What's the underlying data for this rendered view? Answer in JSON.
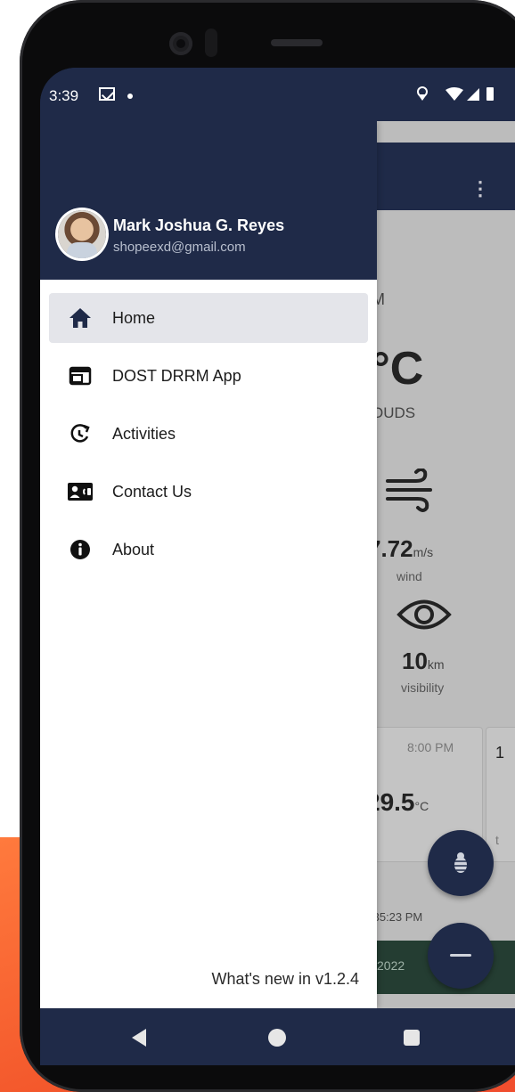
{
  "status_bar": {
    "time": "3:39",
    "right_icons": "⚲ ▾◢▮"
  },
  "background_app": {
    "menu_glyph": "⋮",
    "time_fragment": "M",
    "temp_fragment": "°C",
    "cond_fragment": "OUDS",
    "wind_value": "7.72",
    "wind_unit": "m/s",
    "wind_label": "wind",
    "visibility_value": "10",
    "visibility_unit": "km",
    "visibility_label": "visibility",
    "card_time": "8:00 PM",
    "card_temp": "29.5",
    "card_temp_unit": "°C",
    "card2_fragment": "1",
    "card2_bottom": "t",
    "updated_fragment": ":35:23 PM",
    "green_fragment": "2022"
  },
  "drawer": {
    "user_name": "Mark Joshua G. Reyes",
    "user_email": "shopeexd@gmail.com",
    "items": [
      {
        "label": "Home",
        "icon": "home-icon",
        "active": true
      },
      {
        "label": "DOST DRRM App",
        "icon": "web-app-icon",
        "active": false
      },
      {
        "label": "Activities",
        "icon": "history-icon",
        "active": false
      },
      {
        "label": "Contact Us",
        "icon": "contact-card-icon",
        "active": false
      },
      {
        "label": "About",
        "icon": "info-icon",
        "active": false
      }
    ],
    "version_text": "What's new in v1.2.4"
  },
  "colors": {
    "primary": "#1f2a48",
    "active_item": "#e4e5ea",
    "accent_orange": "#f2542a"
  }
}
